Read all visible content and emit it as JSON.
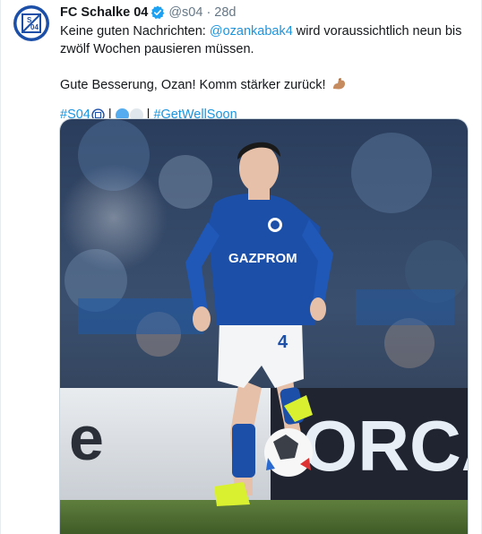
{
  "tweet": {
    "author_name": "FC Schalke 04",
    "handle": "@s04",
    "separator": "·",
    "time": "28d",
    "line1_prefix": "Keine guten Nachrichten: ",
    "mention": "@ozankabak4",
    "line1_suffix": " wird voraussichtlich neun bis zwölf Wochen pausieren müssen.",
    "line2": "Gute Besserung, Ozan! Komm stärker zurück!",
    "hashtag1": "#S04",
    "separator_bar": "|",
    "hashtag2": "#GetWellSoon"
  },
  "media": {
    "jersey_sponsor": "GAZPROM",
    "shirt_number": "4",
    "board_text_left": "e",
    "board_text_right": "ORCA"
  },
  "colors": {
    "link": "#1b95e0",
    "schalke_blue": "#1c4fa8",
    "verified": "#1da1f2"
  },
  "icons": {
    "avatar": "schalke-crest-icon",
    "verified": "verified-badge-icon",
    "flexed_arm": "flexed-biceps-icon"
  }
}
